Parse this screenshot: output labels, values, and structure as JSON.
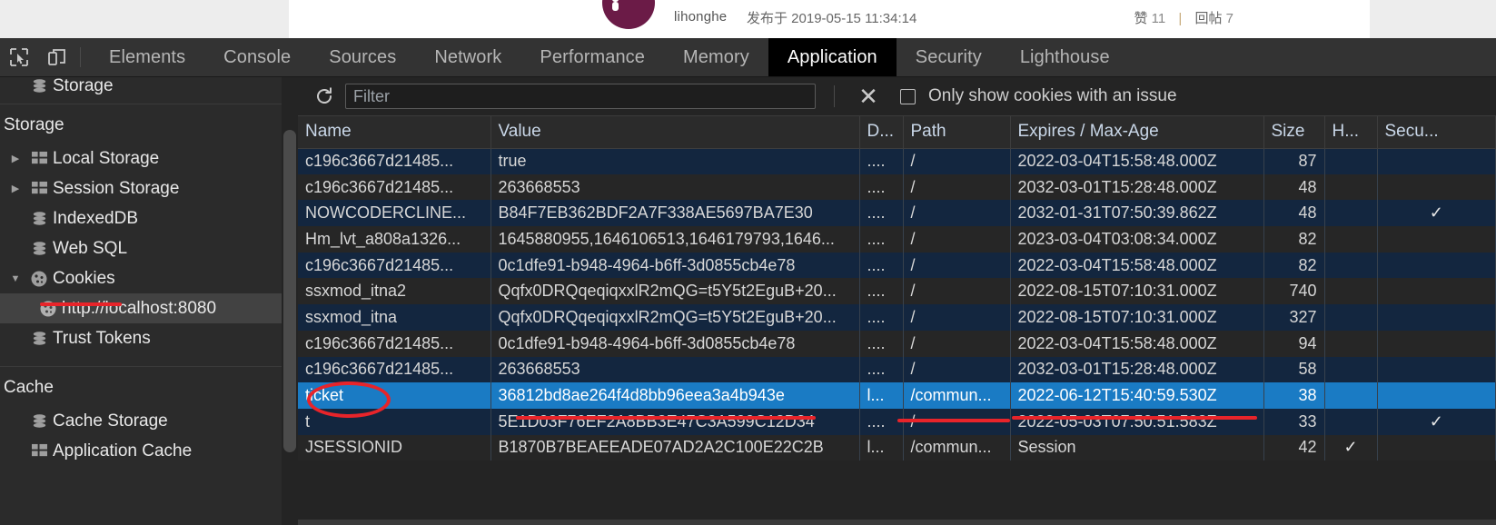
{
  "webpage": {
    "poster_name": "lihonghe",
    "post_time_label": "发布于 2019-05-15 11:34:14",
    "likes_label": "赞",
    "likes_count": "11",
    "separator": "|",
    "replies_label": "回帖",
    "replies_count": "7"
  },
  "devtools": {
    "tabs": [
      {
        "label": "Elements",
        "active": false
      },
      {
        "label": "Console",
        "active": false
      },
      {
        "label": "Sources",
        "active": false
      },
      {
        "label": "Network",
        "active": false
      },
      {
        "label": "Performance",
        "active": false
      },
      {
        "label": "Memory",
        "active": false
      },
      {
        "label": "Application",
        "active": true
      },
      {
        "label": "Security",
        "active": false
      },
      {
        "label": "Lighthouse",
        "active": false
      }
    ],
    "inspect_icon": "inspect-element-icon",
    "device_icon": "device-toolbar-icon"
  },
  "sidebar": {
    "cut_top_item": "Storage",
    "sections": [
      {
        "title": "Storage",
        "items": [
          {
            "label": "Local Storage",
            "icon": "table-icon",
            "twisty": "▶",
            "selected": false
          },
          {
            "label": "Session Storage",
            "icon": "table-icon",
            "twisty": "▶",
            "selected": false
          },
          {
            "label": "IndexedDB",
            "icon": "database-icon",
            "twisty": "",
            "selected": false
          },
          {
            "label": "Web SQL",
            "icon": "database-icon",
            "twisty": "",
            "selected": false
          },
          {
            "label": "Cookies",
            "icon": "cookie-icon",
            "twisty": "▼",
            "selected": false
          },
          {
            "label": "http://localhost:8080",
            "icon": "cookie-icon",
            "twisty": "",
            "selected": true,
            "child": true
          },
          {
            "label": "Trust Tokens",
            "icon": "database-icon",
            "twisty": "",
            "selected": false
          }
        ]
      },
      {
        "title": "Cache",
        "items": [
          {
            "label": "Cache Storage",
            "icon": "database-icon",
            "twisty": "",
            "selected": false
          },
          {
            "label": "Application Cache",
            "icon": "table-icon",
            "twisty": "",
            "selected": false
          }
        ]
      }
    ]
  },
  "toolbar": {
    "refresh_icon": "refresh-icon",
    "filter_placeholder": "Filter",
    "filter_value": "",
    "clear_icon": "clear-icon",
    "only_issues_label": "Only show cookies with an issue",
    "only_issues_checked": false
  },
  "table": {
    "columns": [
      "Name",
      "Value",
      "D...",
      "Path",
      "Expires / Max-Age",
      "Size",
      "H...",
      "Secu..."
    ],
    "rows": [
      {
        "name": "c196c3667d21485...",
        "value": "true",
        "domain": "....",
        "path": "/",
        "expires": "2022-03-04T15:58:48.000Z",
        "size": "87",
        "http_only": "",
        "secure": ""
      },
      {
        "name": "c196c3667d21485...",
        "value": "263668553",
        "domain": "....",
        "path": "/",
        "expires": "2032-03-01T15:28:48.000Z",
        "size": "48",
        "http_only": "",
        "secure": ""
      },
      {
        "name": "NOWCODERCLINE...",
        "value": "B84F7EB362BDF2A7F338AE5697BA7E30",
        "domain": "....",
        "path": "/",
        "expires": "2032-01-31T07:50:39.862Z",
        "size": "48",
        "http_only": "",
        "secure": "✓"
      },
      {
        "name": "Hm_lvt_a808a1326...",
        "value": "1645880955,1646106513,1646179793,1646...",
        "domain": "....",
        "path": "/",
        "expires": "2023-03-04T03:08:34.000Z",
        "size": "82",
        "http_only": "",
        "secure": ""
      },
      {
        "name": "c196c3667d21485...",
        "value": "0c1dfe91-b948-4964-b6ff-3d0855cb4e78",
        "domain": "....",
        "path": "/",
        "expires": "2022-03-04T15:58:48.000Z",
        "size": "82",
        "http_only": "",
        "secure": ""
      },
      {
        "name": "ssxmod_itna2",
        "value": "Qqfx0DRQqeqiqxxlR2mQG=t5Y5t2EguB+20...",
        "domain": "....",
        "path": "/",
        "expires": "2022-08-15T07:10:31.000Z",
        "size": "740",
        "http_only": "",
        "secure": ""
      },
      {
        "name": "ssxmod_itna",
        "value": "Qqfx0DRQqeqiqxxlR2mQG=t5Y5t2EguB+20...",
        "domain": "....",
        "path": "/",
        "expires": "2022-08-15T07:10:31.000Z",
        "size": "327",
        "http_only": "",
        "secure": ""
      },
      {
        "name": "c196c3667d21485...",
        "value": "0c1dfe91-b948-4964-b6ff-3d0855cb4e78",
        "domain": "....",
        "path": "/",
        "expires": "2022-03-04T15:58:48.000Z",
        "size": "94",
        "http_only": "",
        "secure": ""
      },
      {
        "name": "c196c3667d21485...",
        "value": "263668553",
        "domain": "....",
        "path": "/",
        "expires": "2032-03-01T15:28:48.000Z",
        "size": "58",
        "http_only": "",
        "secure": ""
      },
      {
        "name": "ticket",
        "value": "36812bd8ae264f4d8bb96eea3a4b943e",
        "domain": "l...",
        "path": "/commun...",
        "expires": "2022-06-12T15:40:59.530Z",
        "size": "38",
        "http_only": "",
        "secure": ""
      },
      {
        "name": "t",
        "value": "5E1D03F76EF2A8BB3E47C3A599C12D34",
        "domain": "....",
        "path": "/",
        "expires": "2022-05-03T07:50:51.583Z",
        "size": "33",
        "http_only": "",
        "secure": "✓"
      },
      {
        "name": "JSESSIONID",
        "value": "B1870B7BEAEEADE07AD2A2C100E22C2B",
        "domain": "l...",
        "path": "/commun...",
        "expires": "Session",
        "size": "42",
        "http_only": "✓",
        "secure": ""
      }
    ],
    "selected_row_index": 9
  },
  "annotations": {
    "accent_color": "#e8242a",
    "marks": [
      "underline-cookies-sidebar",
      "ellipse-ticket-name",
      "underline-ticket-value",
      "underline-ticket-path",
      "underline-ticket-expires"
    ]
  }
}
